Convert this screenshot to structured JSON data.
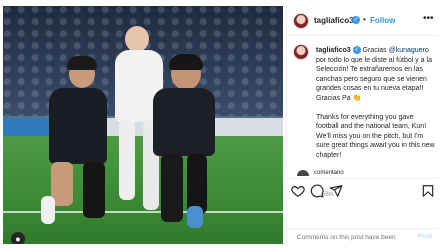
{
  "post": {
    "username": "tagliafico3",
    "follow_label": "Follow",
    "dot": "•",
    "more_label": "•••",
    "caption_user": "tagliafico3",
    "caption_mention": "@kunaguero",
    "caption_es_before_mention": "Gracias",
    "caption_es_after_mention": "por todo lo que le diste al fútbol y a la Selección! Te extrañaremos en las canchas pero seguro que se vienen grandes cosas en tu nueva etapa!! Gracias Pa",
    "caption_en": "Thanks for everything you gave football and the national team, Kun! We'll miss you on the pitch, but I'm sure great things await you in this new chapter!",
    "time": "58m",
    "cut_comment_text": "comentario",
    "add_comment_placeholder": "Comments on this post have been",
    "post_label": "Post",
    "colors": {
      "link": "#3897f0",
      "mention": "#00376b",
      "muted": "#8e8e8e",
      "post_disabled": "#b2dffc"
    },
    "icons": [
      "heart-icon",
      "comment-icon",
      "share-icon",
      "bookmark-icon",
      "verified-badge-icon",
      "more-options-icon",
      "tagged-people-icon"
    ]
  }
}
